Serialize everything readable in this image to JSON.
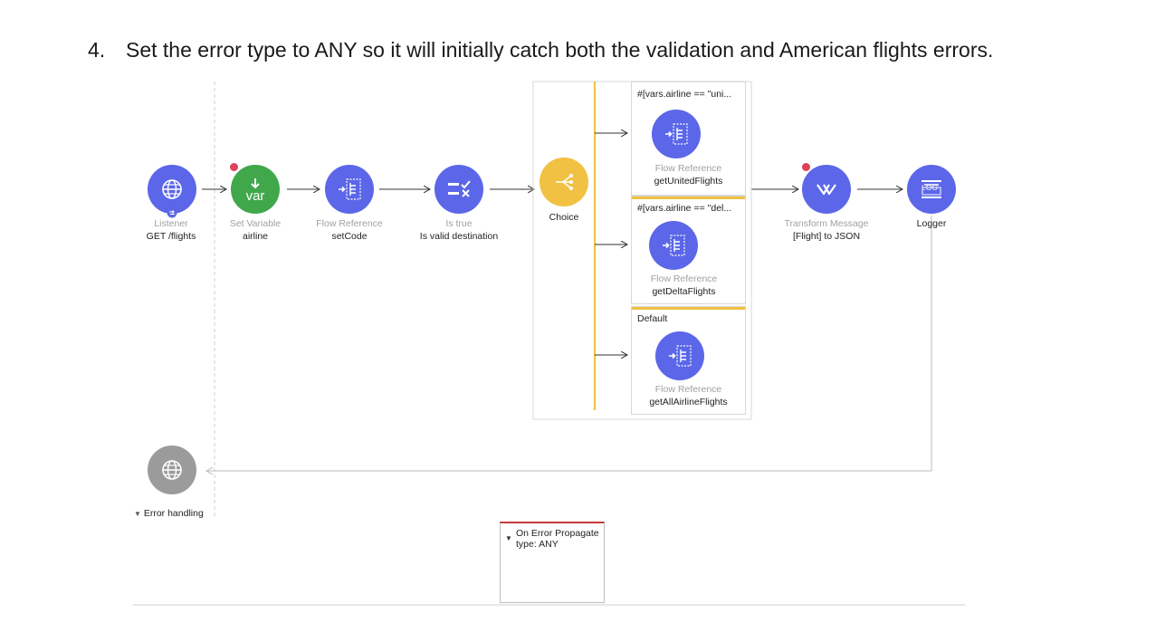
{
  "step": {
    "number": "4.",
    "text": "Set the error type to ANY so it will initially catch both the validation and American flights errors."
  },
  "flow": {
    "listener": {
      "type": "Listener",
      "name": "GET /flights"
    },
    "set_variable": {
      "icon_text": "var",
      "type": "Set Variable",
      "name": "airline"
    },
    "flow_ref_setcode": {
      "type": "Flow Reference",
      "name": "setCode"
    },
    "is_true": {
      "type": "Is true",
      "name": "Is valid destination"
    },
    "choice": {
      "name": "Choice"
    },
    "routes": [
      {
        "condition": "#[vars.airline == \"uni...",
        "type": "Flow Reference",
        "name": "getUnitedFlights"
      },
      {
        "condition": "#[vars.airline == \"del...",
        "type": "Flow Reference",
        "name": "getDeltaFlights"
      },
      {
        "condition": "Default",
        "type": "Flow Reference",
        "name": "getAllAirlineFlights"
      }
    ],
    "transform": {
      "type": "Transform Message",
      "name": "[Flight] to JSON"
    },
    "logger": {
      "icon_text": "LOG",
      "name": "Logger"
    }
  },
  "error_handling": {
    "label": "Error handling",
    "handler_title": "On Error Propagate",
    "handler_type": "type: ANY"
  },
  "colors": {
    "processor_blue": "#5b67e8",
    "variable_green": "#40a84b",
    "choice_yellow": "#f0c143",
    "breakpoint_red": "#e0425a",
    "error_red": "#c23a3a"
  }
}
